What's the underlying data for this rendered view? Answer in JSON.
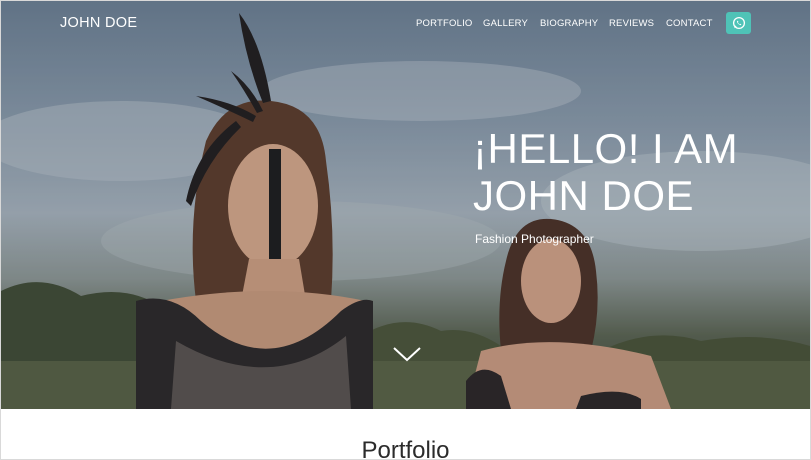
{
  "brand": "JOHN DOE",
  "nav": {
    "items": [
      {
        "label": "PORTFOLIO"
      },
      {
        "label": "GALLERY"
      },
      {
        "label": "BIOGRAPHY"
      },
      {
        "label": "REVIEWS"
      },
      {
        "label": "CONTACT"
      }
    ],
    "whatsapp_icon": "whatsapp-icon"
  },
  "hero": {
    "headline_line1": "¡HELLO! I AM",
    "headline_line2": "JOHN DOE",
    "subtitle": "Fashion Photographer",
    "scroll_icon": "chevron-down-icon"
  },
  "portfolio": {
    "title": "Portfolio"
  },
  "colors": {
    "accent": "#4fc3b7",
    "text_light": "#ffffff",
    "text_dark": "#2b2b2b"
  }
}
